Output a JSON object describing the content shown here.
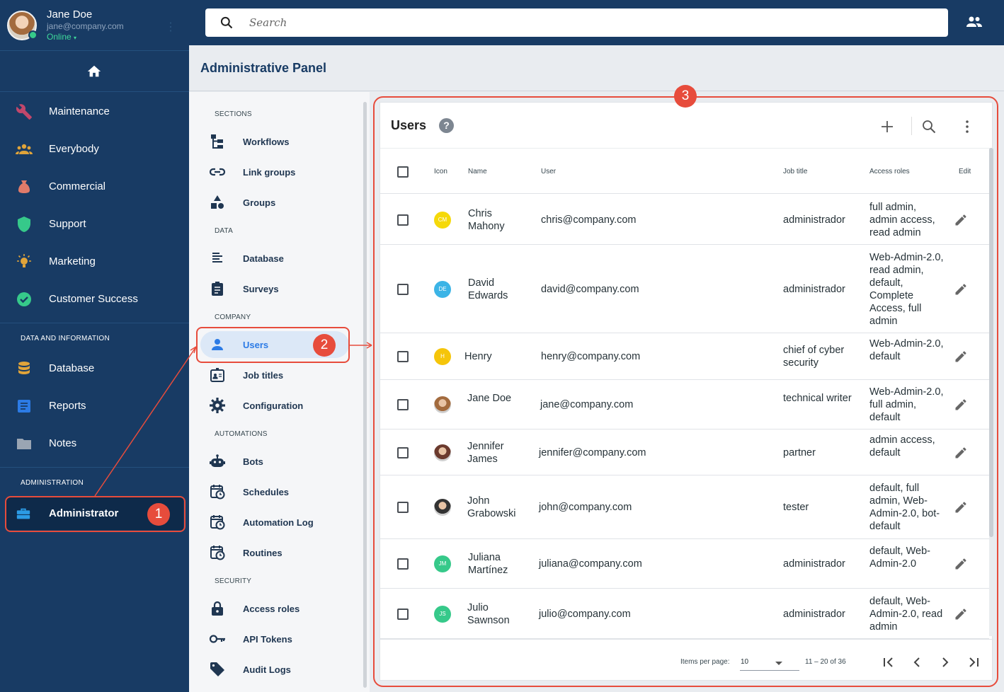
{
  "profile": {
    "name": "Jane Doe",
    "email": "jane@company.com",
    "status": "Online"
  },
  "search": {
    "placeholder": "Search"
  },
  "page_title": "Administrative Panel",
  "leftnav": {
    "items": [
      {
        "label": "Maintenance",
        "icon": "wrench-icon",
        "color": "#c2476b"
      },
      {
        "label": "Everybody",
        "icon": "group-icon",
        "color": "#e0a43a"
      },
      {
        "label": "Commercial",
        "icon": "money-bag-icon",
        "color": "#e07b6a"
      },
      {
        "label": "Support",
        "icon": "shield-icon",
        "color": "#36c98a"
      },
      {
        "label": "Marketing",
        "icon": "bulb-icon",
        "color": "#e0a43a"
      },
      {
        "label": "Customer Success",
        "icon": "check-circle-icon",
        "color": "#36c98a"
      }
    ],
    "section_data": "DATA AND INFORMATION",
    "data_items": [
      {
        "label": "Database",
        "icon": "database-icon",
        "color": "#e0a43a"
      },
      {
        "label": "Reports",
        "icon": "report-icon",
        "color": "#2c7be5"
      },
      {
        "label": "Notes",
        "icon": "folder-icon",
        "color": "#9aa5b3"
      }
    ],
    "section_admin": "ADMINISTRATION",
    "admin_item": {
      "label": "Administrator",
      "icon": "toolbox-icon",
      "color": "#2c9be5"
    }
  },
  "subnav": {
    "sections": [
      "SECTIONS",
      "DATA",
      "COMPANY",
      "AUTOMATIONS",
      "SECURITY"
    ],
    "items": [
      {
        "label": "Workflows",
        "icon": "workflow-icon"
      },
      {
        "label": "Link groups",
        "icon": "link-icon"
      },
      {
        "label": "Groups",
        "icon": "shapes-icon"
      },
      {
        "label": "Database",
        "icon": "list-icon"
      },
      {
        "label": "Surveys",
        "icon": "clipboard-icon"
      },
      {
        "label": "Users",
        "icon": "person-icon"
      },
      {
        "label": "Job titles",
        "icon": "id-card-icon"
      },
      {
        "label": "Configuration",
        "icon": "gear-icon"
      },
      {
        "label": "Bots",
        "icon": "robot-icon"
      },
      {
        "label": "Schedules",
        "icon": "calendar-clock-icon"
      },
      {
        "label": "Automation Log",
        "icon": "calendar-clock-icon"
      },
      {
        "label": "Routines",
        "icon": "calendar-clock-icon"
      },
      {
        "label": "Access roles",
        "icon": "lock-icon"
      },
      {
        "label": "API Tokens",
        "icon": "key-icon"
      },
      {
        "label": "Audit Logs",
        "icon": "tag-icon"
      }
    ]
  },
  "card": {
    "title": "Users",
    "help": "?",
    "columns": [
      "Icon",
      "Name",
      "User",
      "Job title",
      "Access roles",
      "Edit"
    ],
    "rows": [
      {
        "initials": "CM",
        "avatar_color": "#f5d90a",
        "name": "Chris Mahony",
        "user": "chris@company.com",
        "job": "administrador",
        "roles": "full admin, admin access, read admin"
      },
      {
        "initials": "DE",
        "avatar_color": "#3cb4e6",
        "name": "David Edwards",
        "user": "david@company.com",
        "job": "administrador",
        "roles": "Web-Admin-2.0, read admin, default, Complete Access, full admin"
      },
      {
        "initials": "H",
        "avatar_color": "#f5c50a",
        "name": "Henry",
        "user": "henry@company.com",
        "job": "chief of cyber security",
        "roles": "Web-Admin-2.0, default"
      },
      {
        "initials": "",
        "avatar_color": "#a36b3e",
        "name": "Jane Doe",
        "user": "jane@company.com",
        "job": "technical writer",
        "roles": "Web-Admin-2.0, full admin, default"
      },
      {
        "initials": "",
        "avatar_color": "#6b3a2e",
        "name": "Jennifer James",
        "user": "jennifer@company.com",
        "job": "partner",
        "roles": "admin access, default"
      },
      {
        "initials": "",
        "avatar_color": "#333333",
        "name": "John Grabowski",
        "user": "john@company.com",
        "job": "tester",
        "roles": "default, full admin, Web-Admin-2.0, bot-default"
      },
      {
        "initials": "JM",
        "avatar_color": "#36c98a",
        "name": "Juliana Martínez",
        "user": "juliana@company.com",
        "job": "administrador",
        "roles": "default, Web-Admin-2.0"
      },
      {
        "initials": "JS",
        "avatar_color": "#36c98a",
        "name": "Julio Sawnson",
        "user": "julio@company.com",
        "job": "administrador",
        "roles": "default, Web-Admin-2.0, read admin"
      }
    ]
  },
  "paginator": {
    "label": "Items per page:",
    "size": "10",
    "range": "11 – 20 of 36"
  },
  "annotations": [
    "1",
    "2",
    "3"
  ],
  "colors": {
    "nav_bg": "#183b64",
    "accent": "#2c7be5",
    "annotation": "#e74c3c"
  }
}
